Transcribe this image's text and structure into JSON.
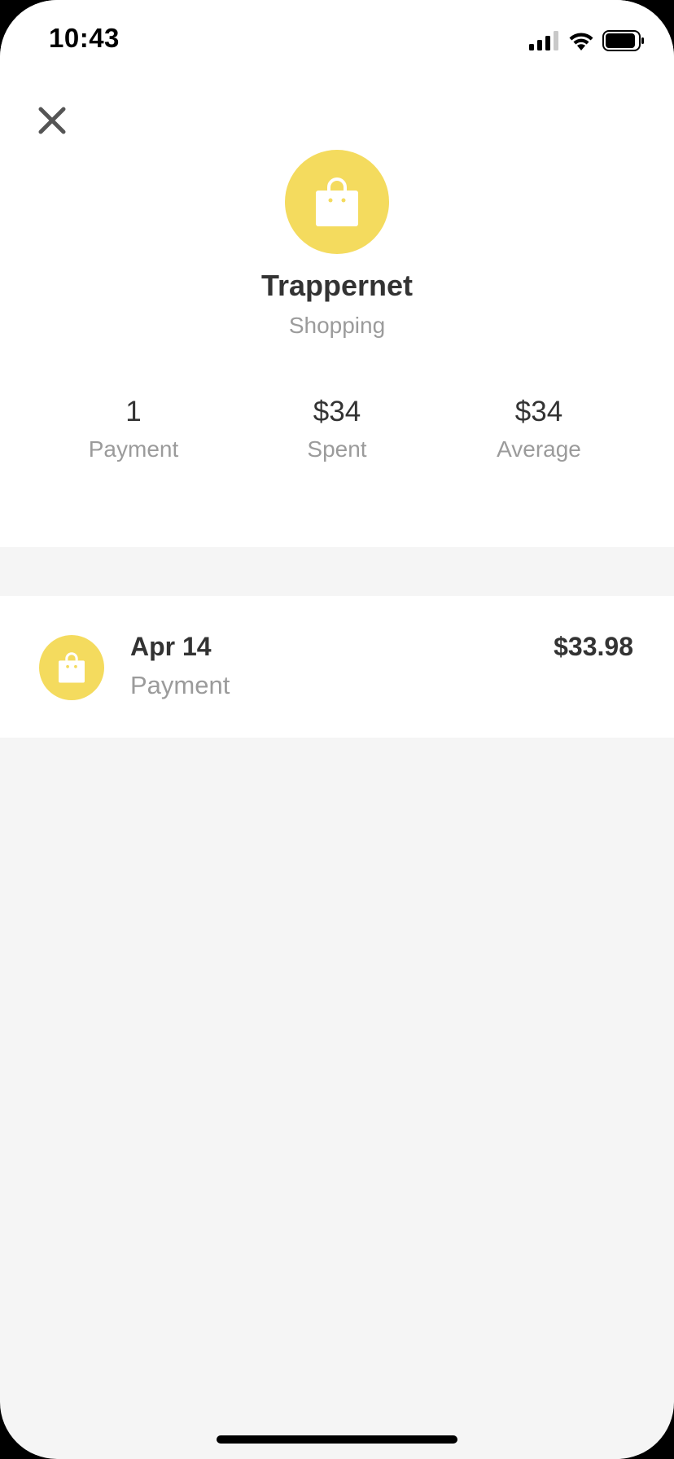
{
  "status_bar": {
    "time": "10:43"
  },
  "colors": {
    "accent": "#f4db5e",
    "text_primary": "#333333",
    "text_secondary": "#9b9b9b"
  },
  "header": {
    "close_icon": "close-icon",
    "merchant_icon": "shopping-bag-icon",
    "merchant_name": "Trappernet",
    "category": "Shopping"
  },
  "stats": [
    {
      "value": "1",
      "label": "Payment"
    },
    {
      "value": "$34",
      "label": "Spent"
    },
    {
      "value": "$34",
      "label": "Average"
    }
  ],
  "transactions": [
    {
      "icon": "shopping-bag-icon",
      "date": "Apr 14",
      "type": "Payment",
      "amount": "$33.98"
    }
  ]
}
